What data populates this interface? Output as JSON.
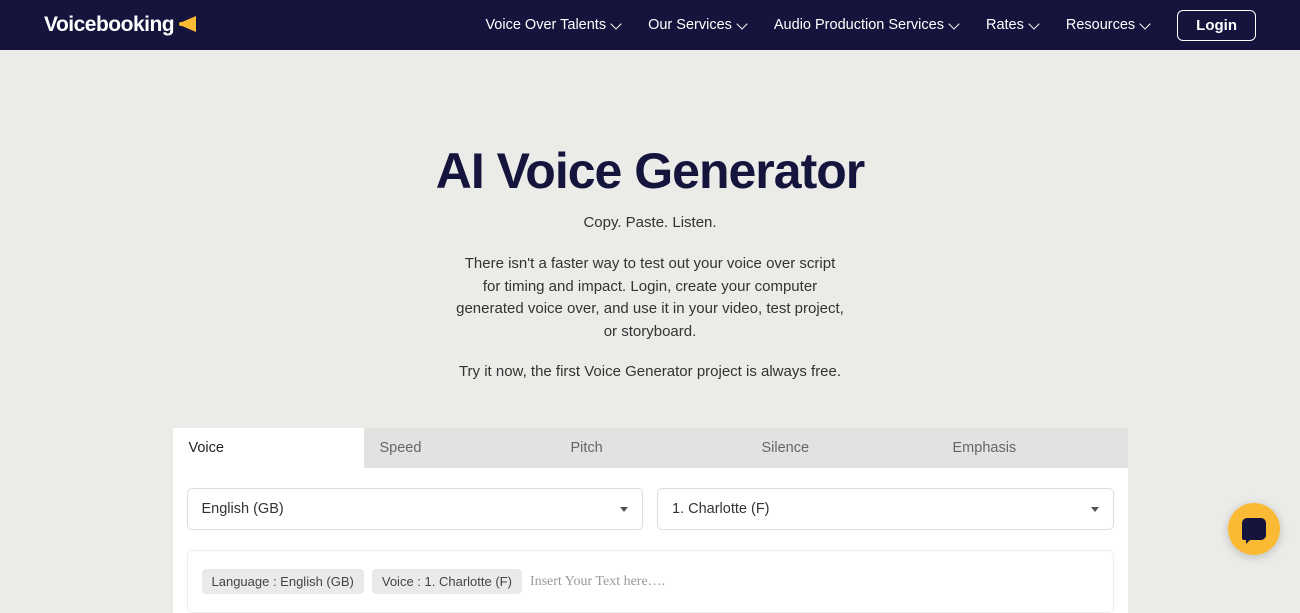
{
  "header": {
    "logo_text": "Voicebooking",
    "nav": [
      "Voice Over Talents",
      "Our Services",
      "Audio Production Services",
      "Rates",
      "Resources"
    ],
    "login": "Login"
  },
  "hero": {
    "title": "AI Voice Generator",
    "tagline": "Copy. Paste. Listen.",
    "description": "There isn't a faster way to test out your voice over script for timing and impact. Login, create your computer generated voice over, and use it in your video, test project, or storyboard.",
    "try_text": "Try it now, the first Voice Generator project is always free."
  },
  "tool": {
    "tabs": [
      "Voice",
      "Speed",
      "Pitch",
      "Silence",
      "Emphasis"
    ],
    "active_tab": 0,
    "language_select": "English (GB)",
    "voice_select": "1. Charlotte (F)",
    "badge_language": "Language : English (GB)",
    "badge_voice": "Voice : 1. Charlotte (F)",
    "placeholder": "Insert Your Text here…."
  }
}
